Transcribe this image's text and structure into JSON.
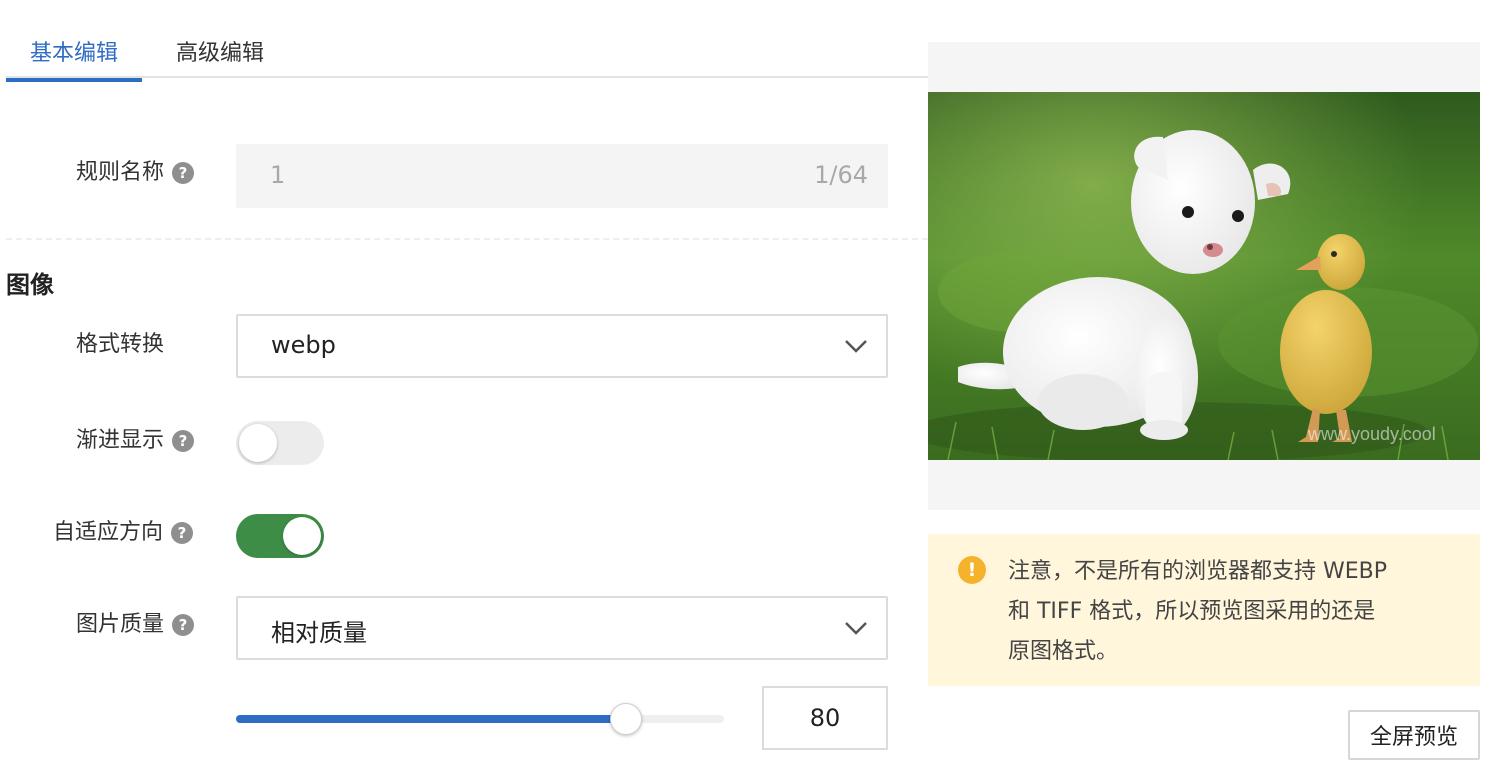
{
  "tabs": [
    {
      "label": "基本编辑",
      "active": true
    },
    {
      "label": "高级编辑",
      "active": false
    }
  ],
  "rule_name": {
    "label": "规则名称",
    "value": "1",
    "counter": "1/64"
  },
  "section_image": "图像",
  "format_convert": {
    "label": "格式转换",
    "value": "webp"
  },
  "progressive": {
    "label": "渐进显示",
    "enabled": false
  },
  "auto_orient": {
    "label": "自适应方向",
    "enabled": true
  },
  "quality": {
    "label": "图片质量",
    "mode": "相对质量",
    "value": "80",
    "fraction": 0.8
  },
  "help_glyph": "?",
  "preview": {
    "watermark": "www.youdy.cool"
  },
  "notice": {
    "icon": "!",
    "line1": "注意，不是所有的浏览器都支持 WEBP",
    "line2": "和 TIFF 格式，所以预览图采用的还是",
    "line3": "原图格式。"
  },
  "fullscreen_label": "全屏预览",
  "colors": {
    "accent": "#2f6cc4",
    "switch_on": "#3d8d46",
    "warning": "#f5b32b",
    "notice_bg": "#fff6dc"
  }
}
